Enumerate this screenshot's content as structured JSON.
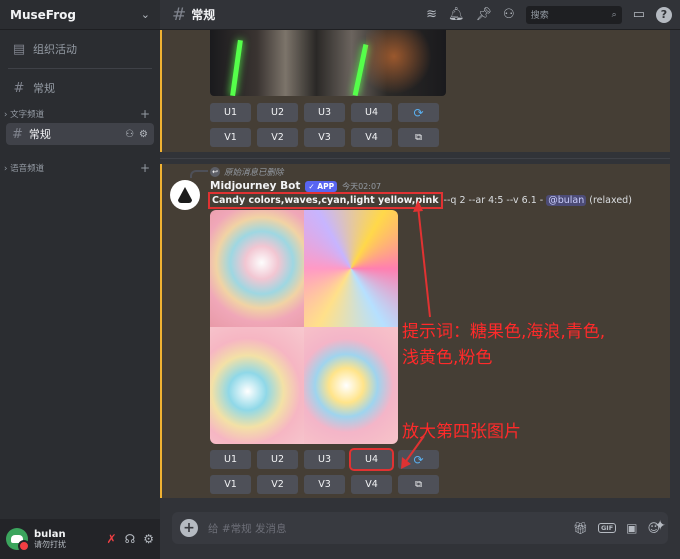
{
  "sidebar": {
    "server_name": "MuseFrog",
    "event_link": "组织活动",
    "general_link": "常规",
    "text_category": "文字频道",
    "active_channel": "常规",
    "voice_category": "语音频道"
  },
  "user": {
    "name": "bulan",
    "status": "请勿打扰"
  },
  "header": {
    "channel_title": "常规",
    "search_placeholder": "搜索"
  },
  "buttons": {
    "upscale": [
      "U1",
      "U2",
      "U3",
      "U4"
    ],
    "variation": [
      "V1",
      "V2",
      "V3",
      "V4"
    ]
  },
  "message": {
    "reply_text": "原始消息已删除",
    "bot_name": "Midjourney Bot",
    "app_badge": "APP",
    "timestamp": "今天02:07",
    "prompt": "Candy colors,waves,cyan,light yellow,pink",
    "params": "--q 2 --ar 4:5 --v 6.1 -",
    "mention": "@bulan",
    "mode": "(relaxed)"
  },
  "annotations": {
    "prompt_line1": "提示词：糖果色,海浪,青色,",
    "prompt_line2": "浅黄色,粉色",
    "upscale_note": "放大第四张图片"
  },
  "composer": {
    "placeholder": "给 #常规 发消息"
  },
  "colors": {
    "accent": "#5865f2",
    "highlight_border": "#f0b232",
    "annotation_red": "#ff2a2a"
  }
}
